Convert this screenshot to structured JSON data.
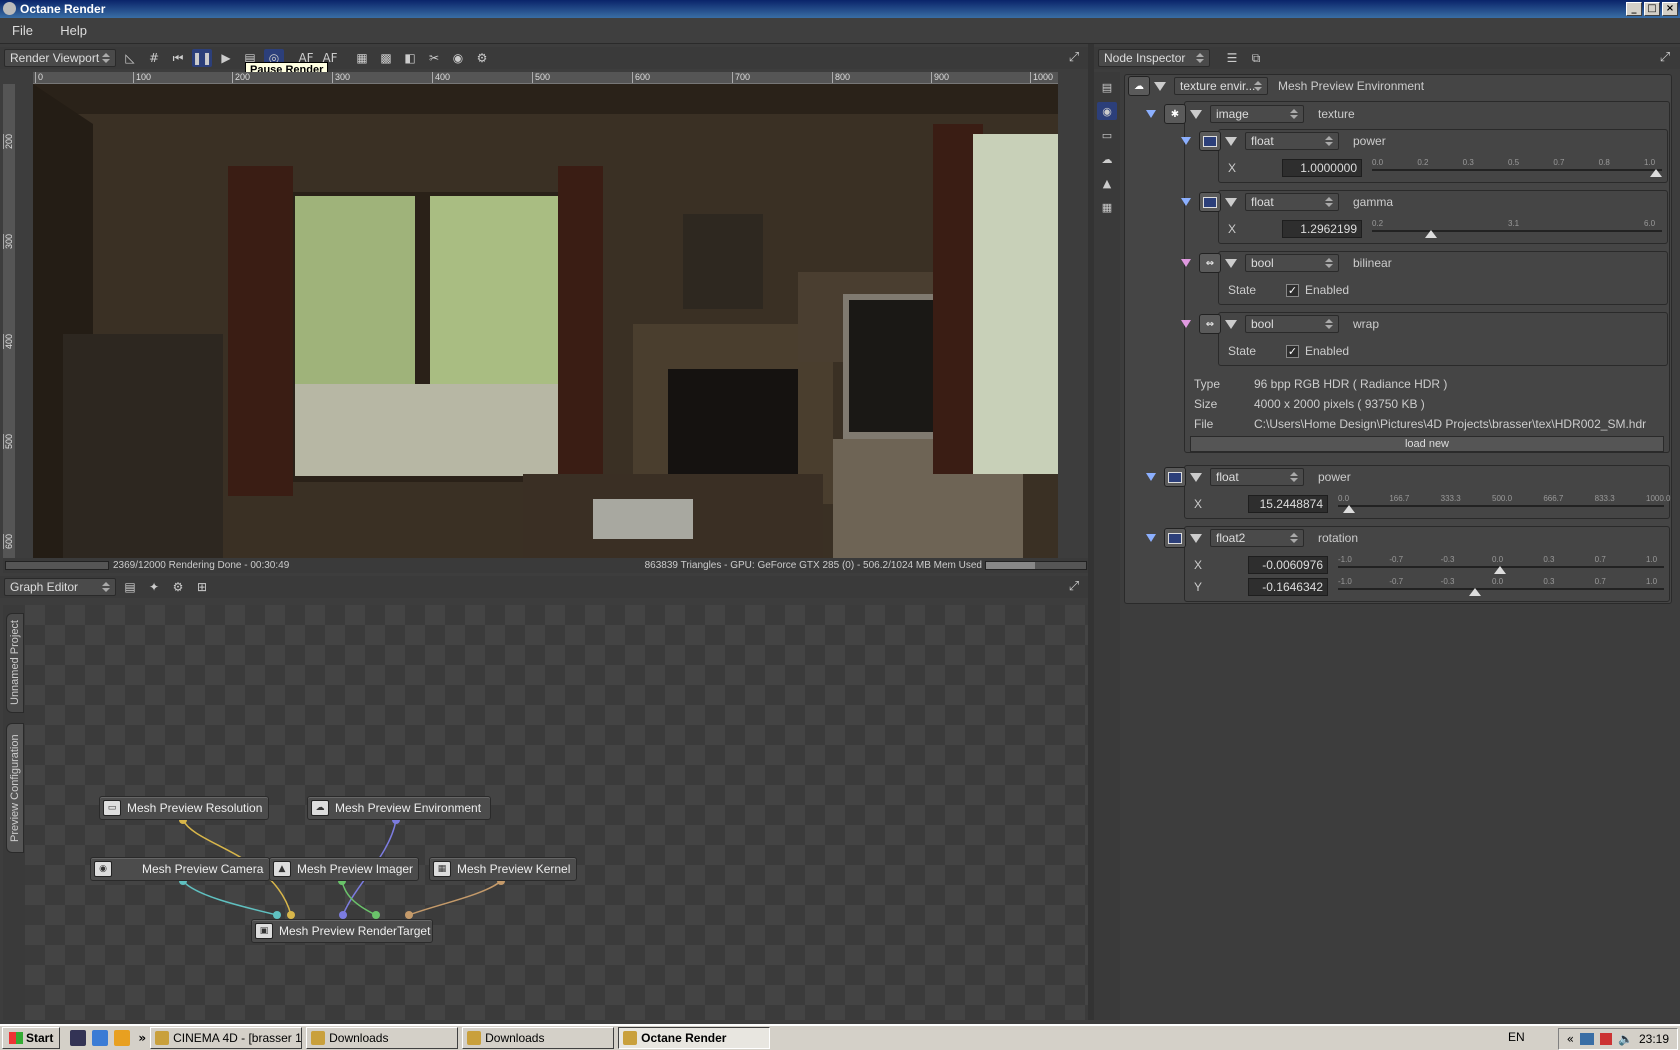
{
  "window": {
    "title": "Octane Render"
  },
  "menu": [
    "File",
    "Help"
  ],
  "viewport": {
    "combo": "Render Viewport",
    "tooltip": "Pause Render",
    "ruler_x": [
      "0",
      "100",
      "200",
      "300",
      "400",
      "500",
      "600",
      "700",
      "800",
      "900",
      "1000"
    ],
    "ruler_y": [
      "200",
      "300",
      "400",
      "500",
      "600"
    ],
    "status_left": "2369/12000 Rendering Done - 00:30:49",
    "status_right": "863839 Triangles - GPU: GeForce GTX 285 (0) - 506.2/1024 MB Mem Used",
    "memory_used_fraction": 0.494
  },
  "graph": {
    "combo": "Graph Editor",
    "tabs": [
      "Unnamed Project",
      "Preview Configuration"
    ],
    "nodes": {
      "resolution": "Mesh Preview Resolution",
      "environment": "Mesh Preview Environment",
      "camera": "Mesh Preview Camera",
      "imager": "Mesh Preview Imager",
      "kernel": "Mesh Preview Kernel",
      "rendertarget": "Mesh Preview RenderTarget"
    }
  },
  "inspector": {
    "combo": "Node Inspector",
    "root": {
      "type": "texture envir...",
      "name": "Mesh Preview Environment"
    },
    "image": {
      "type": "image",
      "name": "texture"
    },
    "power": {
      "type": "float",
      "name": "power",
      "axis": "X",
      "value": "1.0000000",
      "scale": [
        "0.0",
        "0.2",
        "0.3",
        "0.5",
        "0.7",
        "0.8",
        "1.0"
      ],
      "fraction": 1.0
    },
    "gamma": {
      "type": "float",
      "name": "gamma",
      "axis": "X",
      "value": "1.2962199",
      "scale": [
        "0.2",
        "3.1",
        "6.0"
      ],
      "fraction": 0.19
    },
    "bilinear": {
      "type": "bool",
      "name": "bilinear",
      "state_label": "State",
      "state": "Enabled",
      "check": "✓"
    },
    "wrap": {
      "type": "bool",
      "name": "wrap",
      "state_label": "State",
      "state": "Enabled",
      "check": "✓"
    },
    "info": {
      "type_label": "Type",
      "type_value": "96 bpp RGB HDR ( Radiance HDR )",
      "size_label": "Size",
      "size_value": "4000 x 2000 pixels ( 93750 KB )",
      "file_label": "File",
      "file_value": "C:\\Users\\Home Design\\Pictures\\4D Projects\\brasser\\tex\\HDR002_SM.hdr",
      "load_new": "load new"
    },
    "power2": {
      "type": "float",
      "name": "power",
      "axis": "X",
      "value": "15.2448874",
      "scale": [
        "0.0",
        "166.7",
        "333.3",
        "500.0",
        "666.7",
        "833.3",
        "1000.0"
      ],
      "fraction": 0.015
    },
    "rotation": {
      "type": "float2",
      "name": "rotation",
      "axis_x": "X",
      "value_x": "-0.0060976",
      "axis_y": "Y",
      "value_y": "-0.1646342",
      "scale_x": [
        "-1.0",
        "-0.7",
        "-0.3",
        "0.0",
        "0.3",
        "0.7",
        "1.0"
      ],
      "scale_y": [
        "-1.0",
        "-0.7",
        "-0.3",
        "0.0",
        "0.3",
        "0.7",
        "1.0"
      ],
      "fraction_x": 0.497,
      "fraction_y": 0.418
    }
  },
  "taskbar": {
    "start": "Start",
    "tasks": [
      "CINEMA 4D - [brasser 1....",
      "Downloads",
      "Downloads",
      "Octane Render"
    ],
    "lang": "EN",
    "clock": "23:19"
  }
}
